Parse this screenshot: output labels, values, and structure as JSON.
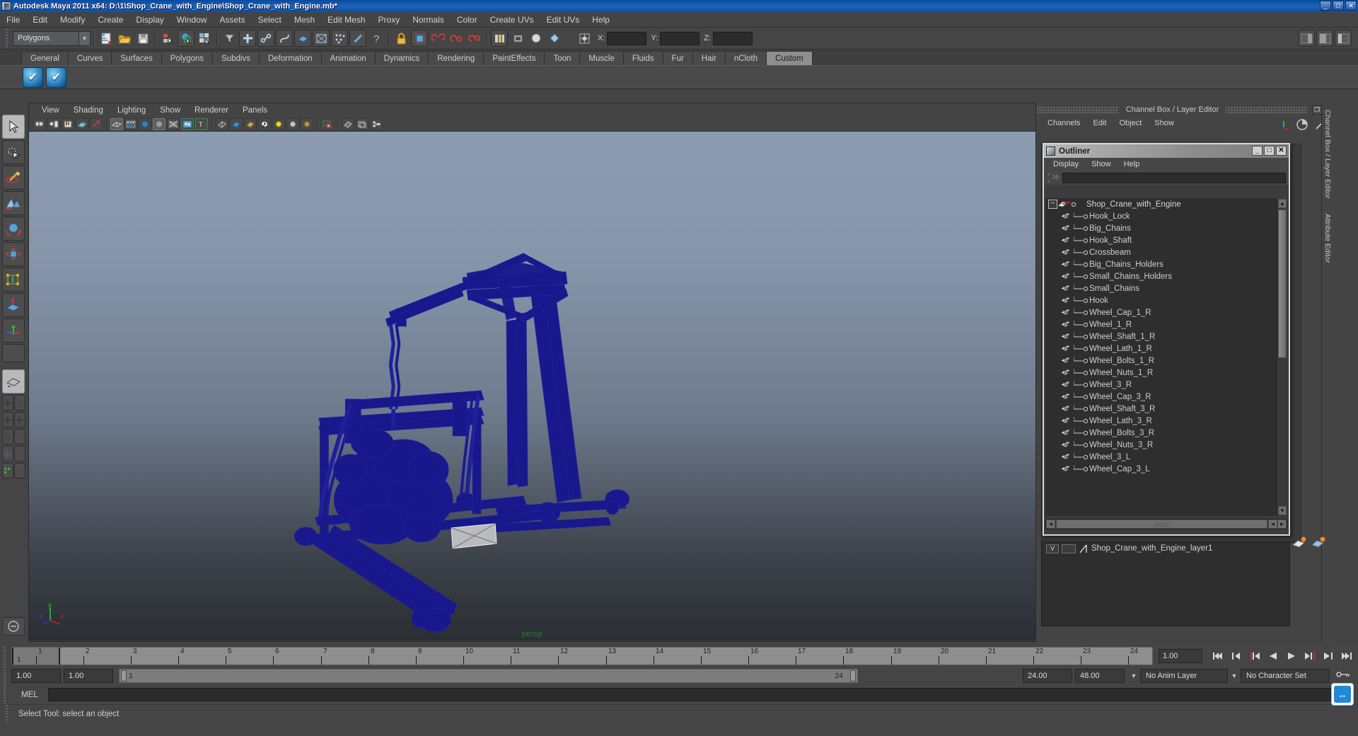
{
  "window": {
    "title": "Autodesk Maya 2011 x64: D:\\1\\Shop_Crane_with_Engine\\Shop_Crane_with_Engine.mb*",
    "minimize": "_",
    "maximize": "□",
    "close": "✕"
  },
  "menubar": {
    "items": [
      "File",
      "Edit",
      "Modify",
      "Create",
      "Display",
      "Window",
      "Assets",
      "Select",
      "Mesh",
      "Edit Mesh",
      "Proxy",
      "Normals",
      "Color",
      "Create UVs",
      "Edit UVs",
      "Help"
    ]
  },
  "toolbar": {
    "menu_set": "Polygons",
    "coord_labels": {
      "x": "X:",
      "y": "Y:",
      "z": "Z:"
    },
    "coord_values": {
      "x": "",
      "y": "",
      "z": ""
    }
  },
  "shelf": {
    "tabs": [
      "General",
      "Curves",
      "Surfaces",
      "Polygons",
      "Subdivs",
      "Deformation",
      "Animation",
      "Dynamics",
      "Rendering",
      "PaintEffects",
      "Toon",
      "Muscle",
      "Fluids",
      "Fur",
      "Hair",
      "nCloth",
      "Custom"
    ],
    "active_tab": "Custom",
    "buttons": [
      "check-shelf-button-1",
      "check-shelf-button-2"
    ]
  },
  "viewport": {
    "menus": [
      "View",
      "Shading",
      "Lighting",
      "Show",
      "Renderer",
      "Panels"
    ],
    "camera_label": "persp",
    "axis": {
      "x": "x",
      "y": "y",
      "z": "z"
    }
  },
  "channel_box": {
    "title": "Channel Box / Layer Editor",
    "menus": [
      "Channels",
      "Edit",
      "Object",
      "Show"
    ],
    "restore": "❐",
    "close": "✕"
  },
  "right_tabs": [
    "Channel Box / Layer Editor",
    "Attribute Editor"
  ],
  "outliner": {
    "title": "Outliner",
    "window_buttons": {
      "minimize": "_",
      "maximize": "□",
      "close": "✕"
    },
    "menus": [
      "Display",
      "Show",
      "Help"
    ],
    "search_value": "",
    "root": {
      "label": "Shop_Crane_with_Engine",
      "expander": "−"
    },
    "items": [
      "Hook_Lock",
      "Big_Chains",
      "Hook_Shaft",
      "Crossbeam",
      "Big_Chains_Holders",
      "Small_Chains_Holders",
      "Small_Chains",
      "Hook",
      "Wheel_Cap_1_R",
      "Wheel_1_R",
      "Wheel_Shaft_1_R",
      "Wheel_Lath_1_R",
      "Wheel_Bolts_1_R",
      "Wheel_Nuts_1_R",
      "Wheel_3_R",
      "Wheel_Cap_3_R",
      "Wheel_Shaft_3_R",
      "Wheel_Lath_3_R",
      "Wheel_Bolts_3_R",
      "Wheel_Nuts_3_R",
      "Wheel_3_L",
      "Wheel_Cap_3_L"
    ],
    "scroll_up": "▲",
    "scroll_down": "▼",
    "scroll_left": "◄",
    "scroll_right": "►"
  },
  "layer_editor": {
    "visibility_flag": "V",
    "layer_name": "Shop_Crane_with_Engine_layer1"
  },
  "time_slider": {
    "current_frame": "1",
    "frame_field": "1.00",
    "ticks": [
      "1",
      "2",
      "3",
      "4",
      "5",
      "6",
      "7",
      "8",
      "9",
      "10",
      "11",
      "12",
      "13",
      "14",
      "15",
      "16",
      "17",
      "18",
      "19",
      "20",
      "21",
      "22",
      "23",
      "24"
    ],
    "playback_buttons": [
      "go-to-start",
      "step-back-key",
      "step-back-frame",
      "play-backwards",
      "play-forwards",
      "step-forward-frame",
      "step-forward-key",
      "go-to-end"
    ]
  },
  "range_slider": {
    "anim_start": "1.00",
    "playback_start": "1.00",
    "range_min_label": "1",
    "range_max_label": "24",
    "playback_end": "24.00",
    "anim_end": "48.00",
    "anim_layer": "No Anim Layer",
    "character_set": "No Character Set"
  },
  "command_line": {
    "label": "MEL",
    "value": ""
  },
  "status_line": {
    "message": "Select Tool: select an object"
  },
  "colors": {
    "title_bar": "#1d63bb",
    "panel_bg": "#454545",
    "viewport_top": "#8b9cb2",
    "viewport_bottom": "#2b2e33",
    "wireframe": "#1a1a8c",
    "camera_label": "#2c7f2c",
    "axis_x": "#d02020",
    "axis_y": "#20c020",
    "axis_z": "#2040d8",
    "active_shelf_tab": "#8e8e8e"
  }
}
